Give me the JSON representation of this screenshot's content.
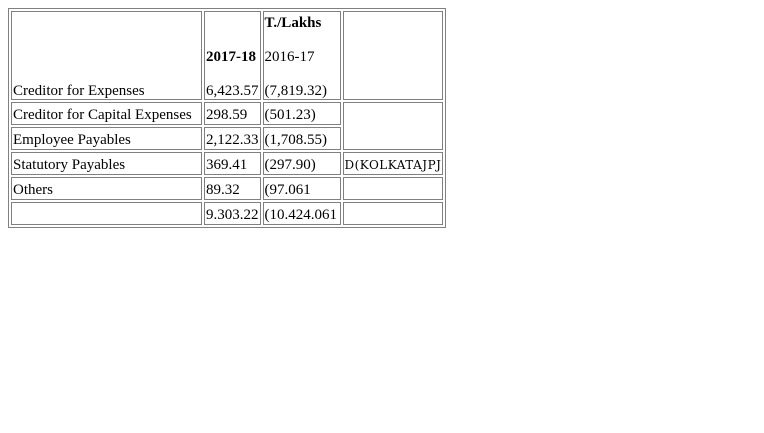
{
  "table": {
    "unit_label": "T./Lakhs",
    "year_current": "2017-18",
    "year_previous": "2016-17",
    "stamp_text": "D(KOLKATAJPJ",
    "rows": [
      {
        "label": "Creditor for Expenses",
        "current": "6,423.57",
        "previous": "(7,819.32)"
      },
      {
        "label": "Creditor for Capital Expenses",
        "current": "298.59",
        "previous": "(501.23)"
      },
      {
        "label": "Employee Payables",
        "current": "2,122.33",
        "previous": "(1,708.55)"
      },
      {
        "label": "Statutory Payables",
        "current": "369.41",
        "previous": "(297.90)"
      },
      {
        "label": "Others",
        "current": "89.32",
        "previous": "(97.061"
      },
      {
        "label": "",
        "current": "9.303.22",
        "previous": "(10.424.061"
      }
    ]
  }
}
